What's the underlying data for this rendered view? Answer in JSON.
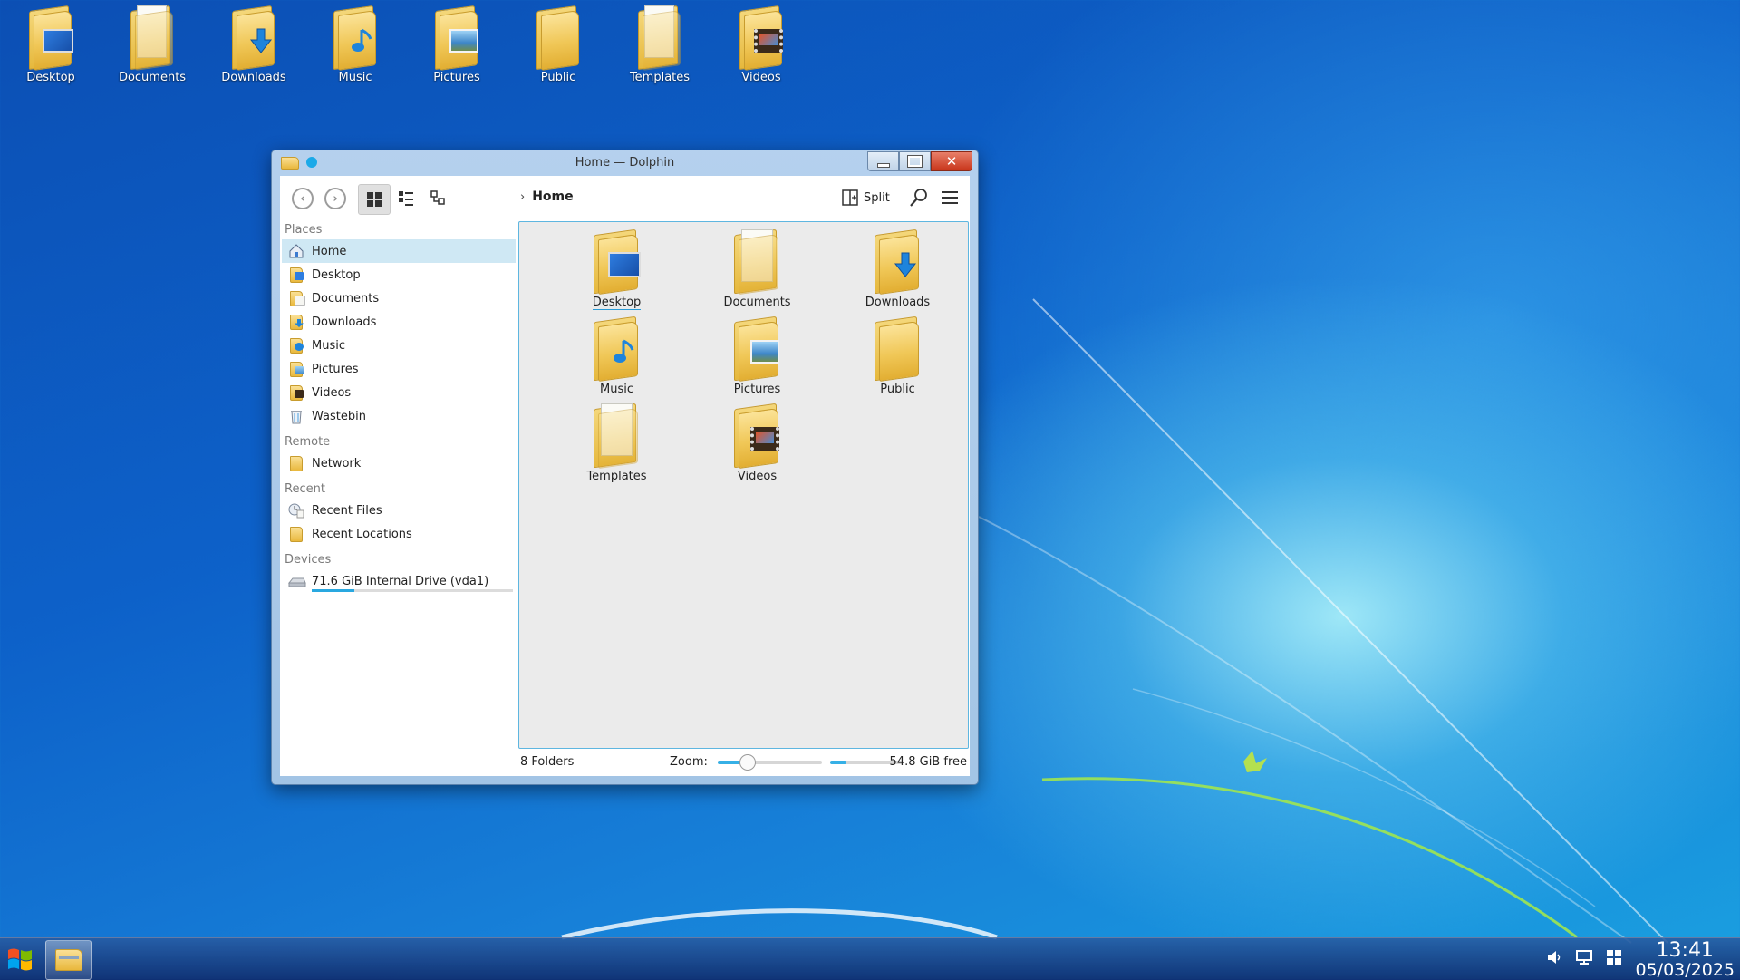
{
  "desktop": {
    "icons": [
      {
        "label": "Desktop",
        "badge": "desktop-screen"
      },
      {
        "label": "Documents",
        "badge": "document"
      },
      {
        "label": "Downloads",
        "badge": "download-arrow"
      },
      {
        "label": "Music",
        "badge": "music-note"
      },
      {
        "label": "Pictures",
        "badge": "picture"
      },
      {
        "label": "Public",
        "badge": "none"
      },
      {
        "label": "Templates",
        "badge": "template"
      },
      {
        "label": "Videos",
        "badge": "film"
      }
    ]
  },
  "window": {
    "title": "Home — Dolphin",
    "toolbar": {
      "breadcrumb": "Home",
      "split_label": "Split"
    },
    "places": {
      "sections": {
        "places": "Places",
        "remote": "Remote",
        "recent": "Recent",
        "devices": "Devices"
      },
      "items": [
        {
          "label": "Home"
        },
        {
          "label": "Desktop"
        },
        {
          "label": "Documents"
        },
        {
          "label": "Downloads"
        },
        {
          "label": "Music"
        },
        {
          "label": "Pictures"
        },
        {
          "label": "Videos"
        },
        {
          "label": "Wastebin"
        }
      ],
      "remote_items": [
        {
          "label": "Network"
        }
      ],
      "recent_items": [
        {
          "label": "Recent Files"
        },
        {
          "label": "Recent Locations"
        }
      ],
      "devices": [
        {
          "label": "71.6 GiB Internal Drive (vda1)",
          "used_fraction": 0.21
        }
      ]
    },
    "content": {
      "items": [
        {
          "label": "Desktop"
        },
        {
          "label": "Documents"
        },
        {
          "label": "Downloads"
        },
        {
          "label": "Music"
        },
        {
          "label": "Pictures"
        },
        {
          "label": "Public"
        },
        {
          "label": "Templates"
        },
        {
          "label": "Videos"
        }
      ]
    },
    "statusbar": {
      "count": "8 Folders",
      "zoom_label": "Zoom:",
      "zoom_fraction": 0.28,
      "space_used_fraction": 0.22,
      "free": "54.8 GiB free"
    }
  },
  "taskbar": {
    "time": "13:41",
    "date": "05/03/2025"
  }
}
